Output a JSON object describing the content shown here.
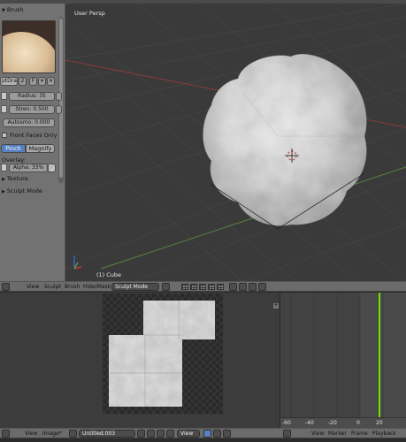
{
  "tool_shelf": {
    "brush_panel_title": "Brush",
    "brush_name": "ptDraw",
    "brush_users": "2",
    "brush_fake_user": "F",
    "radius_label": "Radius: 35",
    "strength_label": "Stren: 0.500",
    "autosmooth_label": "Autosmo: 0.000",
    "front_faces_label": "Front Faces Only",
    "pinch_label": "Pinch",
    "magnify_label": "Magnify",
    "overlay_label": "Overlay:",
    "alpha_label": "Alpha: 33%",
    "texture_panel_title": "Texture",
    "sculpt_mode_panel_title": "Sculpt Mode"
  },
  "viewport": {
    "view_label": "User Persp",
    "object_label": "(1) Cube"
  },
  "viewport_header": {
    "view": "View",
    "sculpt": "Sculpt",
    "brush": "Brush",
    "hide_mask": "Hide/Mask",
    "mode_select": "Sculpt Mode"
  },
  "image_editor_header": {
    "view": "View",
    "image": "Image*",
    "image_name": "Untitled.003",
    "view2": "View"
  },
  "timeline_header": {
    "view": "View",
    "marker": "Marker",
    "frame": "Frame",
    "playback": "Playback"
  },
  "timeline": {
    "ticks": [
      "-60",
      "-40",
      "-20",
      "0",
      "20"
    ]
  },
  "colors": {
    "active_button": "#5680c2",
    "current_frame": "#6ee000",
    "grid_x_axis": "#a03a3a",
    "grid_y_axis": "#5c9a3e"
  }
}
